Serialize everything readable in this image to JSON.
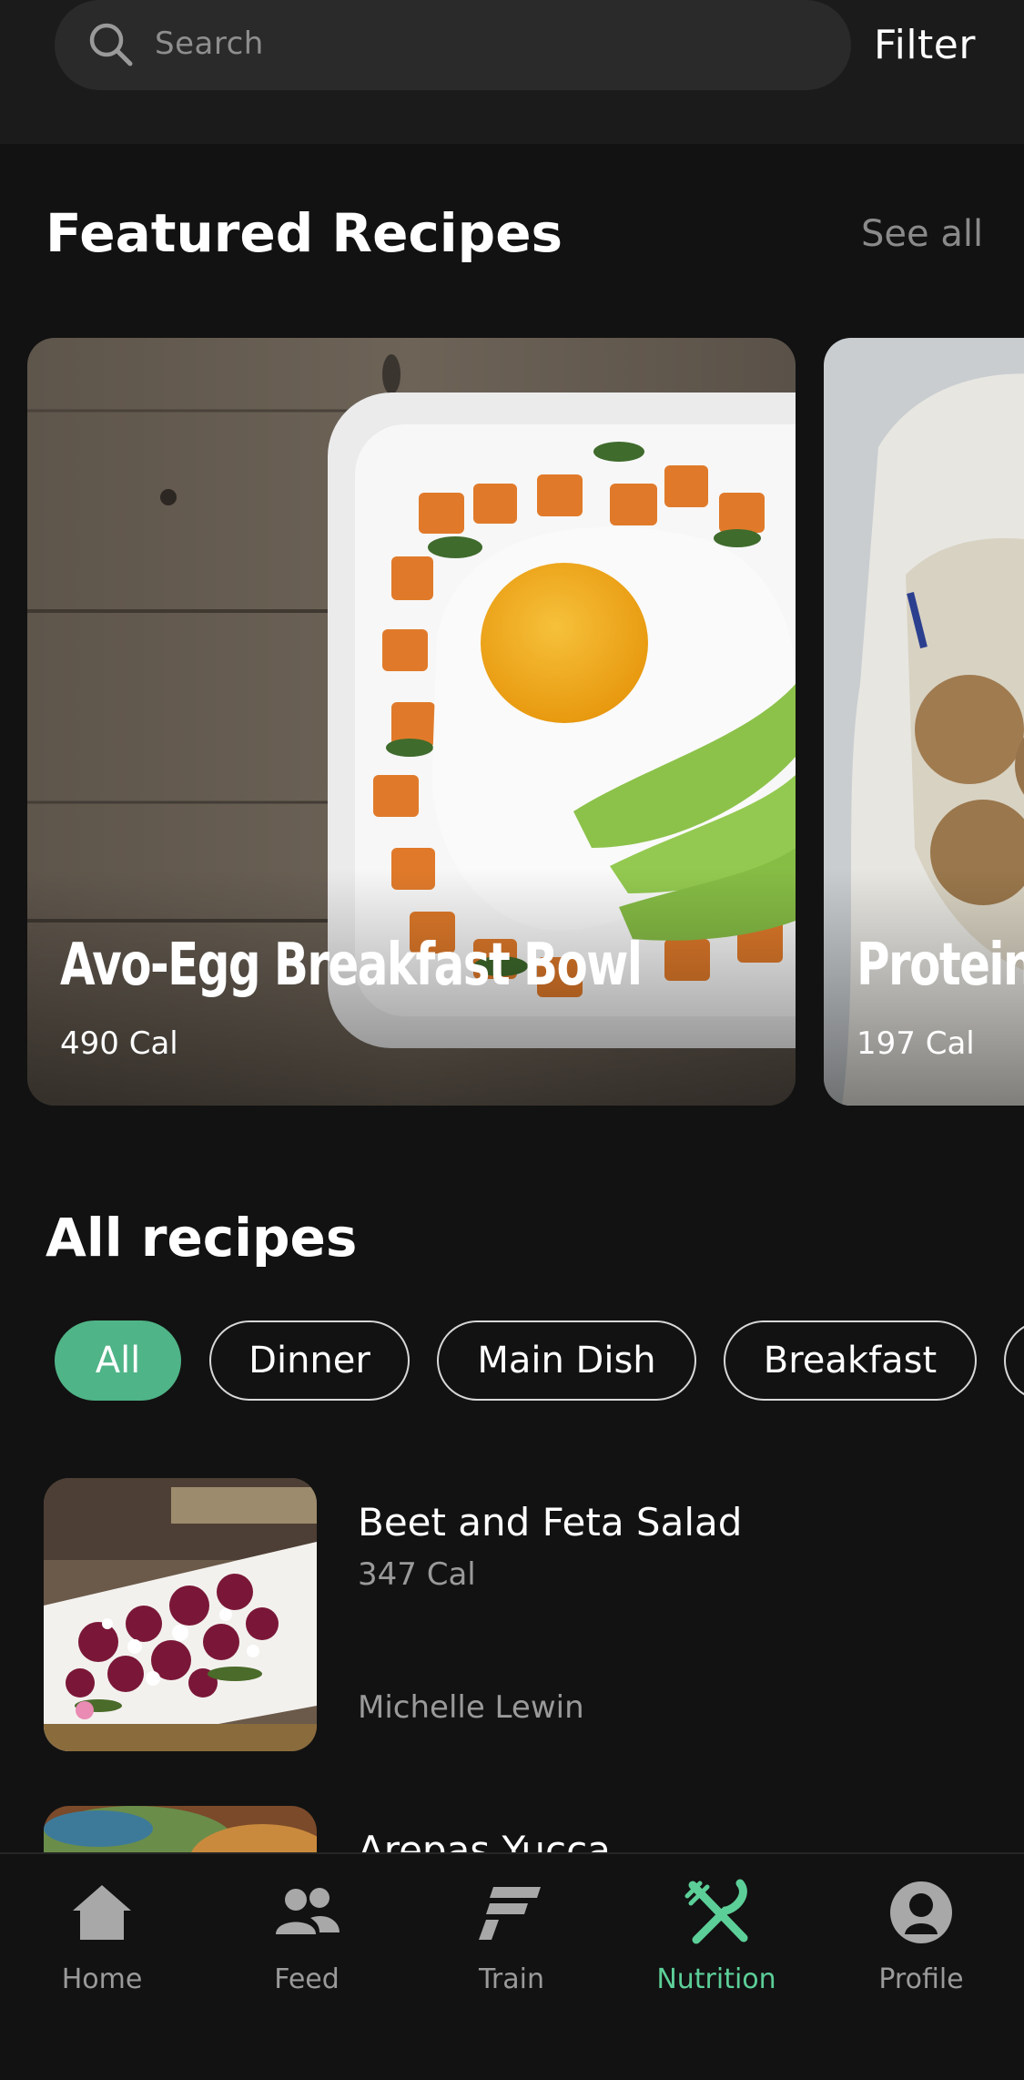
{
  "search": {
    "placeholder": "Search",
    "filter_label": "Filter"
  },
  "featured": {
    "title": "Featured Recipes",
    "see_all": "See all",
    "cards": [
      {
        "title": "Avo-Egg Breakfast Bowl",
        "calories": "490 Cal"
      },
      {
        "title": "Protein",
        "calories": "197 Cal"
      }
    ]
  },
  "all_recipes": {
    "title": "All recipes",
    "chips": [
      "All",
      "Dinner",
      "Main Dish",
      "Breakfast"
    ],
    "active_chip": "All",
    "items": [
      {
        "name": "Beet and Feta Salad",
        "calories": "347 Cal",
        "author": "Michelle Lewin"
      },
      {
        "name": "Arepas Yucca"
      }
    ]
  },
  "nav": {
    "items": [
      {
        "label": "Home",
        "icon": "home-icon"
      },
      {
        "label": "Feed",
        "icon": "people-icon"
      },
      {
        "label": "Train",
        "icon": "train-icon"
      },
      {
        "label": "Nutrition",
        "icon": "fork-knife-icon"
      },
      {
        "label": "Profile",
        "icon": "profile-icon"
      }
    ],
    "active": "Nutrition"
  },
  "colors": {
    "accent": "#4fb487",
    "nav_active": "#5ccf98",
    "background": "#121212"
  }
}
